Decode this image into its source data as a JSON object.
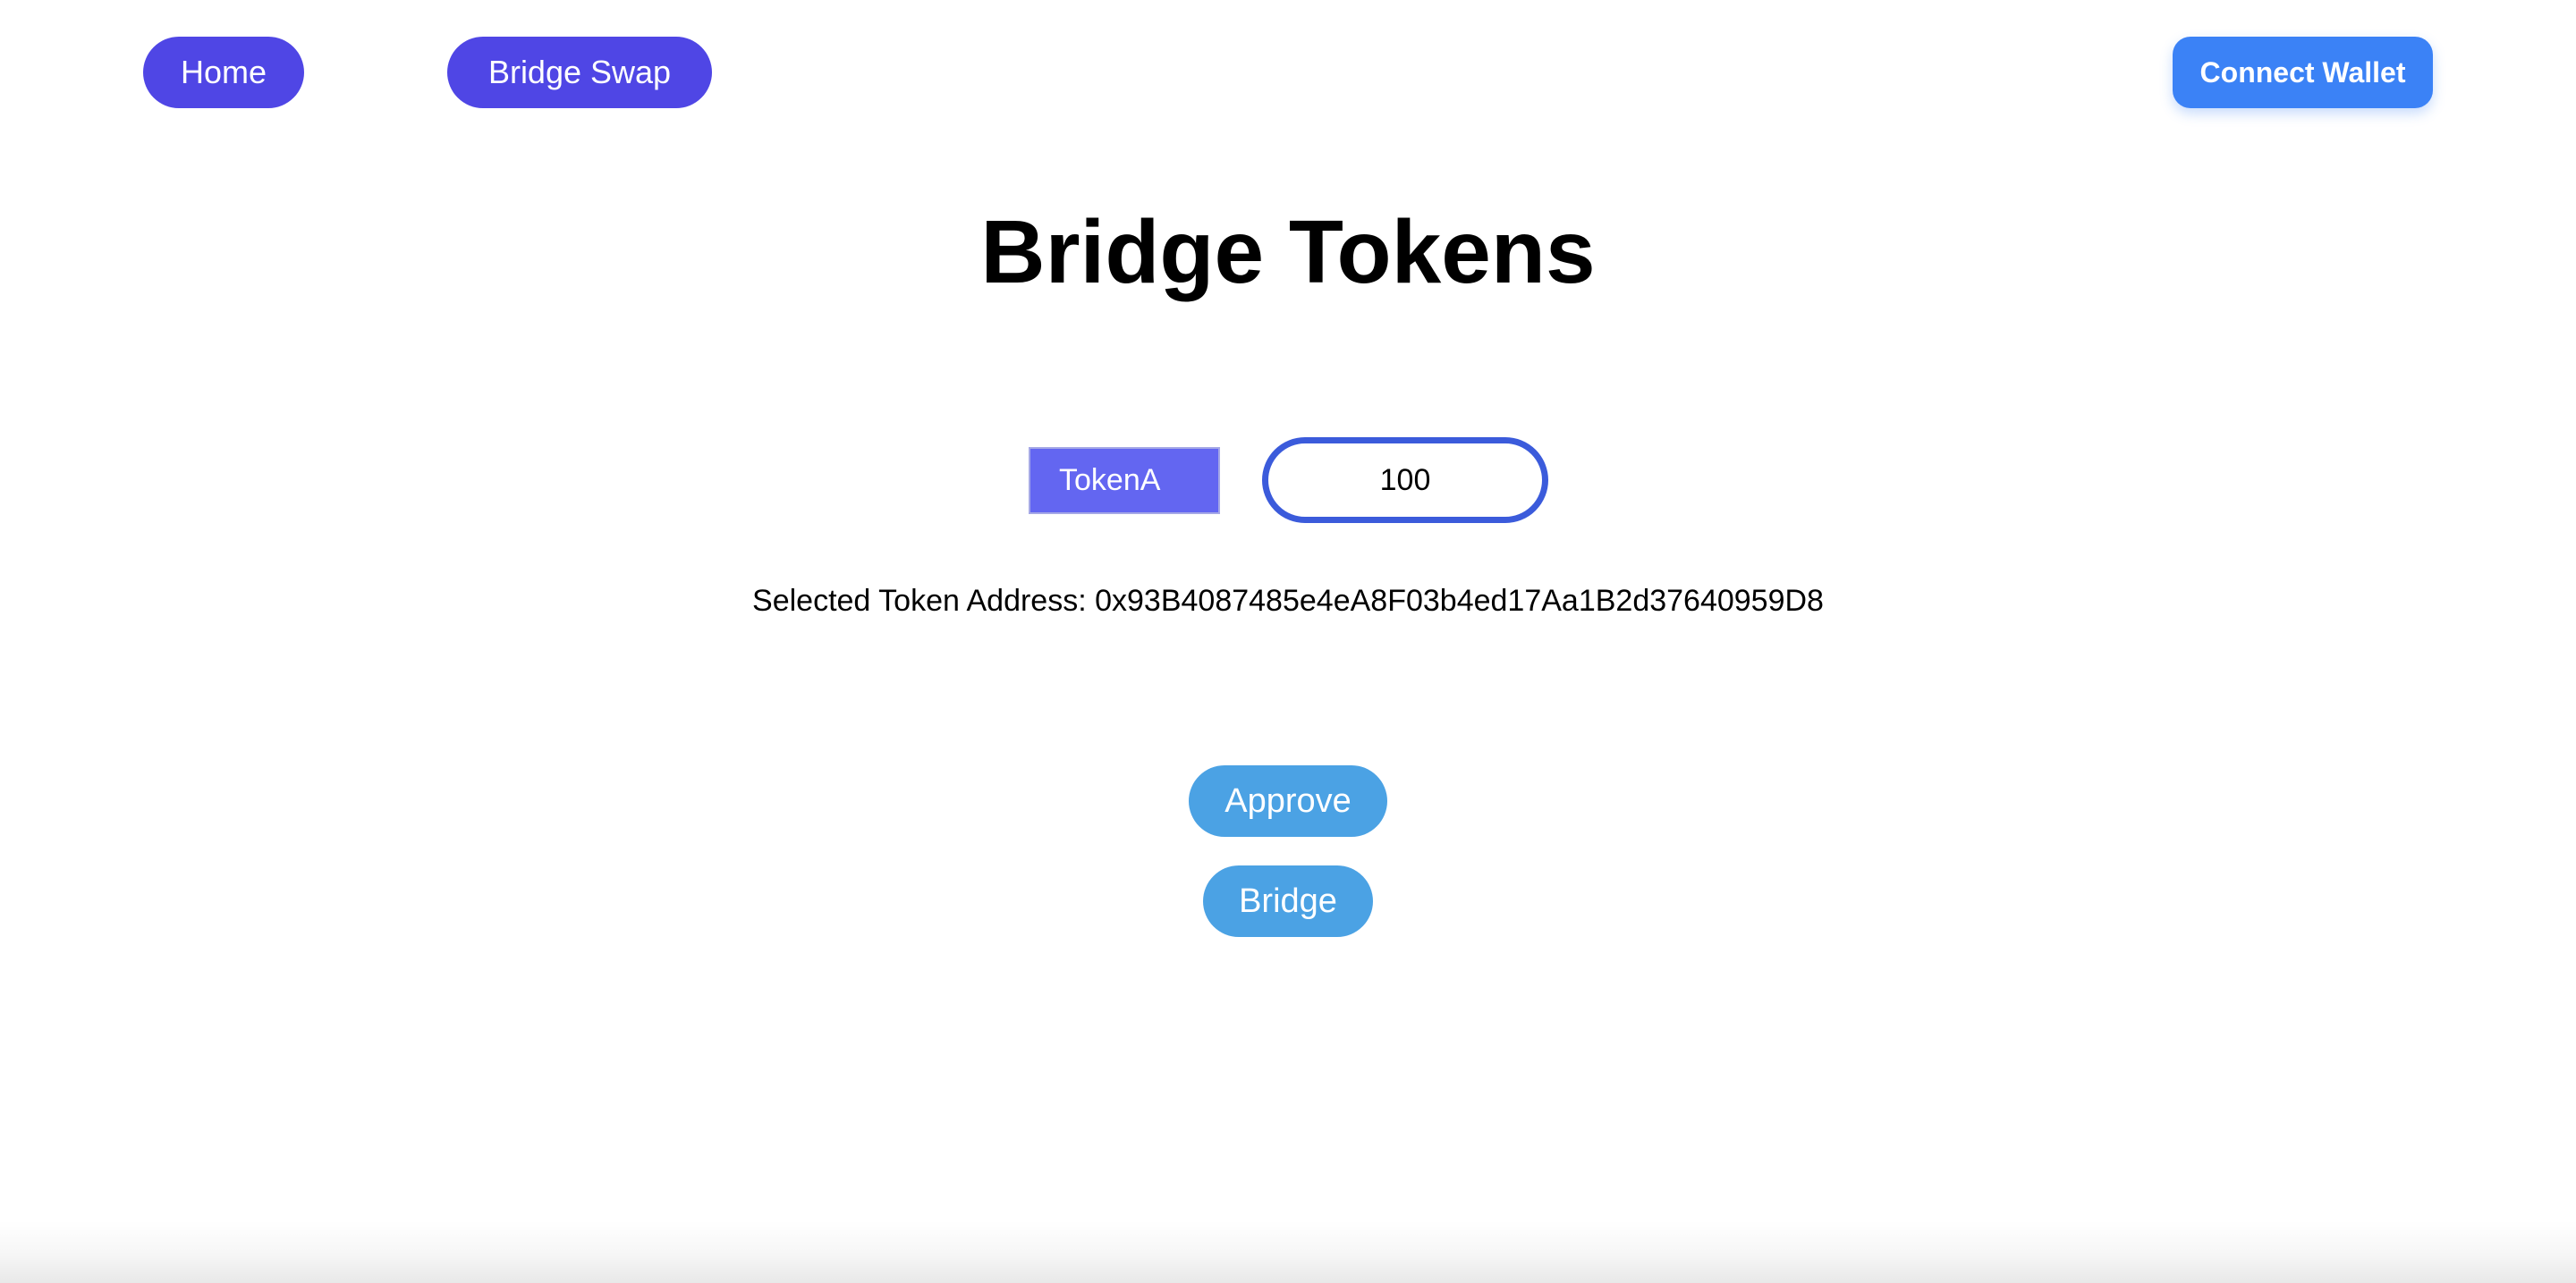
{
  "nav": {
    "home_label": "Home",
    "bridge_swap_label": "Bridge Swap",
    "connect_wallet_label": "Connect Wallet"
  },
  "main": {
    "title": "Bridge Tokens",
    "token_select": {
      "selected": "TokenA"
    },
    "amount": {
      "value": "100"
    },
    "selected_address": {
      "label": "Selected Token Address:",
      "value": "0x93B4087485e4eA8F03b4ed17Aa1B2d37640959D8"
    },
    "approve_label": "Approve",
    "bridge_label": "Bridge"
  },
  "colors": {
    "nav_button": "#4f46e5",
    "connect_wallet": "#3b82f6",
    "token_select": "#6366f1",
    "amount_border": "#3b5bdb",
    "action_button": "#4ba2e4",
    "background": "#ffffff",
    "text": "#000000"
  }
}
